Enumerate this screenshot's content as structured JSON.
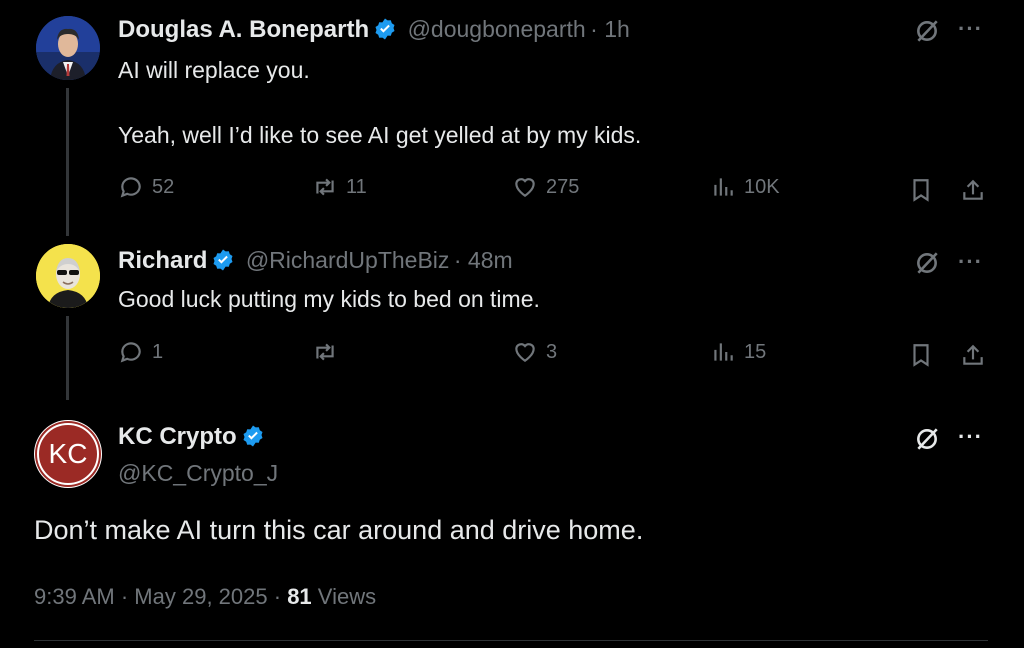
{
  "tweets": [
    {
      "name": "Douglas A. Boneparth",
      "handle": "@dougboneparth",
      "time": "· 1h",
      "lines": [
        "AI will replace you.",
        "Yeah, well I’d like to see AI get yelled at by my kids."
      ],
      "replies": "52",
      "retweets": "11",
      "likes": "275",
      "views": "10K"
    },
    {
      "name": "Richard",
      "handle": "@RichardUpTheBiz",
      "time": "· 48m",
      "lines": [
        "Good luck putting my kids to bed on time."
      ],
      "replies": "1",
      "retweets": "",
      "likes": "3",
      "views": "15"
    }
  ],
  "main_tweet": {
    "name": "KC Crypto",
    "handle": "@KC_Crypto_J",
    "avatar_text": "KC",
    "text": "Don’t make AI turn this car around and drive home.",
    "time": "9:39 AM",
    "date": "May 29, 2025",
    "views_count": "81",
    "views_label": "Views"
  },
  "more_label": "···",
  "colors": {
    "verified": "#1d9bf0",
    "muted": "#71767b",
    "kc_red": "#9b2a25",
    "richard_bg": "#f4e24c"
  }
}
